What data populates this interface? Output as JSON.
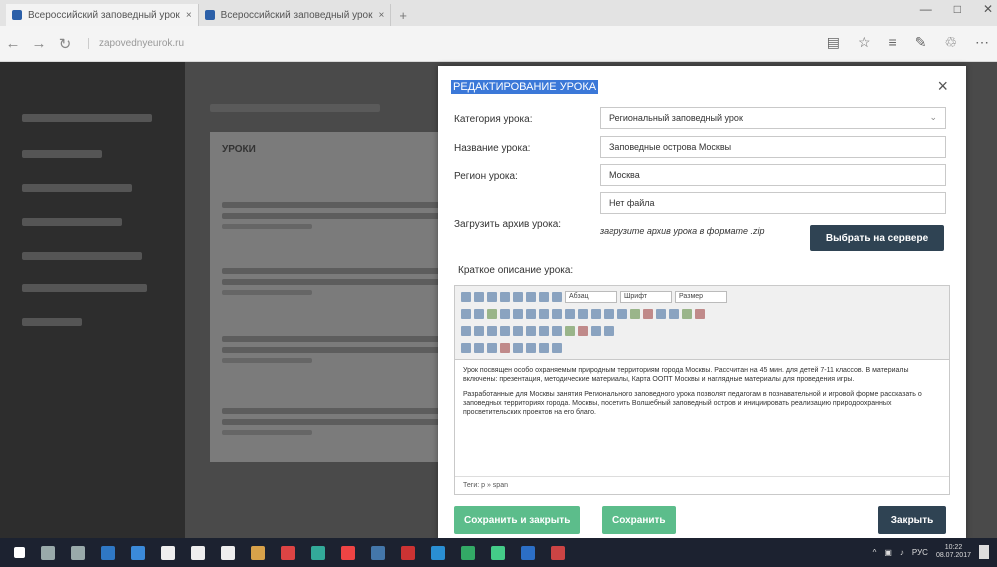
{
  "browser": {
    "tabs": [
      {
        "label": "Всероссийский заповедный урок"
      },
      {
        "label": "Всероссийский заповедный урок"
      }
    ],
    "new_tab": "+",
    "url": "zapovednyeurok.ru"
  },
  "modal": {
    "title": "РЕДАКТИРОВАНИЕ УРОКА",
    "close": "×",
    "fields": {
      "category_label": "Категория урока:",
      "category_value": "Региональный заповедный урок",
      "name_label": "Название урока:",
      "name_value": "Заповедные острова Москвы",
      "region_label": "Регион урока:",
      "region_value": "Москва",
      "file_value": "Нет файла",
      "upload_label": "Загрузить архив урока:",
      "upload_hint": "загрузите архив урока в формате .zip",
      "server_button": "Выбрать на сервере",
      "desc_label": "Краткое описание урока:"
    },
    "editor": {
      "format_select": "Абзац",
      "font_select": "Шрифт",
      "size_select": "Размер",
      "paragraph_1": "Урок посвящен особо охраняемым природным территориям города Москвы. Рассчитан на 45 мин. для детей 7-11 классов. В материалы включены: презентация, методические материалы, Карта ООПТ Москвы и наглядные материалы для проведения игры.",
      "paragraph_2": "Разработанные для Москвы занятия Регионального заповедного урока позволят педагогам в познавательной и игровой форме рассказать о заповедных территориях города. Москвы, посетить Волшебный заповедный остров и инициировать реализацию природоохранных просветительских проектов на его благо.",
      "status": "Теги: p » span"
    },
    "buttons": {
      "save_close": "Сохранить и закрыть",
      "save": "Сохранить",
      "close": "Закрыть"
    }
  },
  "page": {
    "card_title": "УРОКИ"
  },
  "taskbar": {
    "lang": "РУС",
    "time": "10:22",
    "date": "08.07.2017"
  },
  "colors": {
    "accent_blue": "#3b78d8",
    "green": "#5cbd8b",
    "dark": "#2f4353"
  }
}
